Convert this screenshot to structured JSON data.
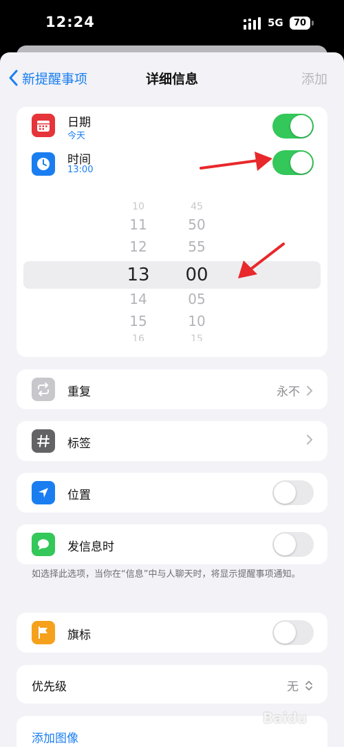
{
  "status_bar": {
    "time": "12:24",
    "network": "5G",
    "battery": "70"
  },
  "nav": {
    "back_label": "新提醒事项",
    "title": "详细信息",
    "add_label": "添加"
  },
  "date_row": {
    "label": "日期",
    "value": "今天",
    "toggle_on": true,
    "icon": "calendar-icon",
    "icon_color": "#e5343a"
  },
  "time_row": {
    "label": "时间",
    "value": "13:00",
    "toggle_on": true,
    "icon": "clock-icon",
    "icon_color": "#1a7ef0"
  },
  "time_picker": {
    "hours": [
      "10",
      "11",
      "12",
      "13",
      "14",
      "15",
      "16"
    ],
    "minutes": [
      "45",
      "50",
      "55",
      "00",
      "05",
      "10",
      "15"
    ],
    "selected_hour": "13",
    "selected_minute": "00"
  },
  "repeat_row": {
    "label": "重复",
    "value": "永不",
    "icon": "repeat-icon",
    "icon_color": "#c7c7cc"
  },
  "tag_row": {
    "label": "标签",
    "icon": "hashtag-icon",
    "icon_color": "#636366"
  },
  "location_row": {
    "label": "位置",
    "toggle_on": false,
    "icon": "location-arrow-icon",
    "icon_color": "#1a7ef0"
  },
  "message_row": {
    "label": "发信息时",
    "toggle_on": false,
    "icon": "message-bubble-icon",
    "icon_color": "#34c759"
  },
  "message_footnote": "如选择此选项，当你在“信息”中与人聊天时，将显示提醒事项通知。",
  "flag_row": {
    "label": "旗标",
    "toggle_on": false,
    "icon": "flag-icon",
    "icon_color": "#f5a11c"
  },
  "priority_row": {
    "label": "优先级",
    "value": "无"
  },
  "add_image": {
    "label": "添加图像"
  },
  "watermark": "Baidu"
}
